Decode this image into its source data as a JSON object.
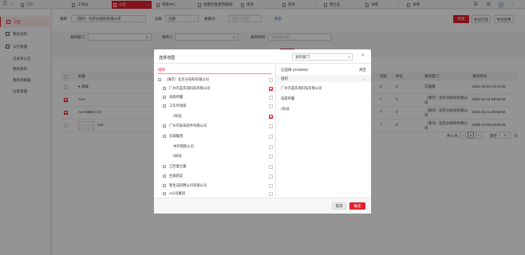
{
  "topbar": {
    "tabs": [
      {
        "label": "门户",
        "active": false
      },
      {
        "label": "工作台",
        "active": false
      },
      {
        "label": "公告",
        "active": true
      },
      {
        "label": "审批中心",
        "active": false
      },
      {
        "label": "批量检查费用报销",
        "active": false
      },
      {
        "label": "更多",
        "active": false
      },
      {
        "label": "更多",
        "active": false
      },
      {
        "label": "更企业",
        "active": false
      },
      {
        "label": "详情",
        "active": false
      },
      {
        "label": "详情",
        "active": false
      }
    ]
  },
  "sidebar": {
    "items": [
      {
        "label": "公告",
        "active": true
      },
      {
        "label": "我关注的"
      },
      {
        "label": "公告管理"
      }
    ],
    "sub_items": [
      "已发布公告",
      "我的发布",
      "我的草稿箱",
      "分类管理"
    ]
  },
  "filters": {
    "scope_label": "组织",
    "scope_value": "（演示）北京分技科有限公司",
    "category_label": "分类",
    "category_value": "全部",
    "keyword_label": "关键词",
    "keyword_placeholder": "请输入标题",
    "search_link": "搜索",
    "new_button": "新建",
    "mark_read_button": "标记已读",
    "export_button": "导出变更",
    "dept_label": "发布部门",
    "publisher_label": "发布人",
    "time_label": "发布时间",
    "time_placeholder": "请选择日期",
    "query_button": "查询"
  },
  "table": {
    "headers": [
      "标题",
      "浏览",
      "评论",
      "发布部门",
      "发布时间"
    ],
    "rows": [
      {
        "title": "● 测试",
        "views": "0",
        "comments": "0",
        "dept": "实施部",
        "time": "2021-02-22 10:41:03",
        "checked": false
      },
      {
        "title": "AAA",
        "views": "7",
        "comments": "0",
        "dept": "（演示）北京分技科有限公司",
        "time": "2021-01-11 09:52:24",
        "checked": true
      },
      {
        "title": "AAA BBB CCC",
        "views": "7",
        "comments": "0",
        "dept": "（演示）北京分技科有限公司",
        "time": "2021-01-11 09:50:54",
        "checked": true
      },
      {
        "title": "123",
        "views": "7",
        "comments": "0",
        "dept": "（演示）北京分技科有限公司",
        "time": "2020-12-09 10:06:01",
        "checked": false
      }
    ]
  },
  "pagination": {
    "total": "共 4 条",
    "current_page": "1",
    "goto_label": "跳至",
    "goto_value": "1",
    "page_suffix": "页"
  },
  "modal": {
    "title": "选择范围",
    "search_value": "发布部门",
    "left_header": "组织",
    "tree": [
      {
        "label": "（演示）北京分技科有限公司",
        "level": 0,
        "expander": "−",
        "checked": false
      },
      {
        "label": "广州市蓝氏商科技有限公司",
        "level": 1,
        "expander": "+",
        "checked": true
      },
      {
        "label": "海南所署",
        "level": 1,
        "expander": "+",
        "checked": false
      },
      {
        "label": "工作环境部",
        "level": 1,
        "expander": "+",
        "checked": false
      },
      {
        "label": "c科技",
        "level": 2,
        "expander": "",
        "checked": true
      },
      {
        "label": "广州市辰发软件有限公司",
        "level": 1,
        "expander": "+",
        "checked": false
      },
      {
        "label": "东城集团",
        "level": 1,
        "expander": "+",
        "checked": false
      },
      {
        "label": "中环销售公司",
        "level": 2,
        "expander": "",
        "checked": false
      },
      {
        "label": "b科技",
        "level": 2,
        "expander": "",
        "checked": false
      },
      {
        "label": "江西富士康",
        "level": 1,
        "expander": "+",
        "checked": false
      },
      {
        "label": "生意新友",
        "level": 1,
        "expander": "+",
        "checked": false
      },
      {
        "label": "新生成招聘公司有限公司",
        "level": 1,
        "expander": "+",
        "checked": false
      },
      {
        "label": "A公司集团",
        "level": 1,
        "expander": "+",
        "checked": false
      }
    ],
    "selected_header": "已选择 (3/15000)",
    "clear_label": "清空",
    "group_label": "组织",
    "selected_items": [
      "广州市蓝氏商科技有限公司",
      "海南所署",
      "c科技"
    ],
    "cancel_button": "取消",
    "confirm_button": "确定"
  },
  "colors": {
    "accent": "#e41f2b",
    "link": "#3a7bd5"
  }
}
